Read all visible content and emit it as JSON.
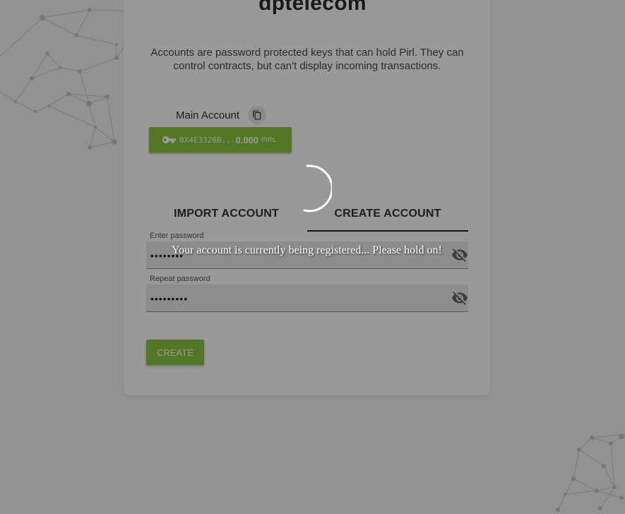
{
  "brand": {
    "title": "dptelecom"
  },
  "intro": {
    "description": "Accounts are password protected keys that can hold Pirl. They can control contracts, but can't display incoming transactions."
  },
  "account": {
    "label": "Main Account",
    "address": "0X4E3326B...",
    "balance": "0.000",
    "unit": "PIRL",
    "icons": {
      "copy": "copy-icon",
      "key": "key-icon"
    }
  },
  "tabs": [
    {
      "label": "IMPORT ACCOUNT",
      "active": false
    },
    {
      "label": "CREATE ACCOUNT",
      "active": true
    }
  ],
  "form": {
    "password": {
      "label": "Enter password",
      "value": "••••••••",
      "icon": "eye-off-icon"
    },
    "repeat": {
      "label": "Repeat password",
      "value": "•••••••••",
      "icon": "eye-off-icon"
    },
    "submit_label": "CREATE"
  },
  "loading": {
    "message": "Your account is currently being registered... Please hold on!"
  },
  "colors": {
    "accent": "#8cc63f",
    "background": "#f4f4f4",
    "card": "#ffffff",
    "overlay": "rgba(0,0,0,0.4)"
  }
}
